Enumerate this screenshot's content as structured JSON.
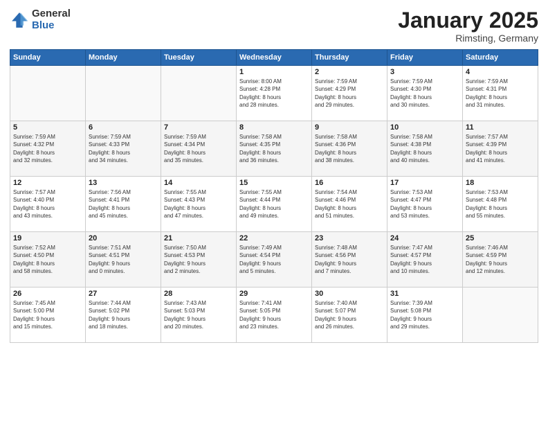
{
  "logo": {
    "general": "General",
    "blue": "Blue"
  },
  "title": "January 2025",
  "subtitle": "Rimsting, Germany",
  "headers": [
    "Sunday",
    "Monday",
    "Tuesday",
    "Wednesday",
    "Thursday",
    "Friday",
    "Saturday"
  ],
  "weeks": [
    [
      {
        "day": "",
        "info": ""
      },
      {
        "day": "",
        "info": ""
      },
      {
        "day": "",
        "info": ""
      },
      {
        "day": "1",
        "info": "Sunrise: 8:00 AM\nSunset: 4:28 PM\nDaylight: 8 hours\nand 28 minutes."
      },
      {
        "day": "2",
        "info": "Sunrise: 7:59 AM\nSunset: 4:29 PM\nDaylight: 8 hours\nand 29 minutes."
      },
      {
        "day": "3",
        "info": "Sunrise: 7:59 AM\nSunset: 4:30 PM\nDaylight: 8 hours\nand 30 minutes."
      },
      {
        "day": "4",
        "info": "Sunrise: 7:59 AM\nSunset: 4:31 PM\nDaylight: 8 hours\nand 31 minutes."
      }
    ],
    [
      {
        "day": "5",
        "info": "Sunrise: 7:59 AM\nSunset: 4:32 PM\nDaylight: 8 hours\nand 32 minutes."
      },
      {
        "day": "6",
        "info": "Sunrise: 7:59 AM\nSunset: 4:33 PM\nDaylight: 8 hours\nand 34 minutes."
      },
      {
        "day": "7",
        "info": "Sunrise: 7:59 AM\nSunset: 4:34 PM\nDaylight: 8 hours\nand 35 minutes."
      },
      {
        "day": "8",
        "info": "Sunrise: 7:58 AM\nSunset: 4:35 PM\nDaylight: 8 hours\nand 36 minutes."
      },
      {
        "day": "9",
        "info": "Sunrise: 7:58 AM\nSunset: 4:36 PM\nDaylight: 8 hours\nand 38 minutes."
      },
      {
        "day": "10",
        "info": "Sunrise: 7:58 AM\nSunset: 4:38 PM\nDaylight: 8 hours\nand 40 minutes."
      },
      {
        "day": "11",
        "info": "Sunrise: 7:57 AM\nSunset: 4:39 PM\nDaylight: 8 hours\nand 41 minutes."
      }
    ],
    [
      {
        "day": "12",
        "info": "Sunrise: 7:57 AM\nSunset: 4:40 PM\nDaylight: 8 hours\nand 43 minutes."
      },
      {
        "day": "13",
        "info": "Sunrise: 7:56 AM\nSunset: 4:41 PM\nDaylight: 8 hours\nand 45 minutes."
      },
      {
        "day": "14",
        "info": "Sunrise: 7:55 AM\nSunset: 4:43 PM\nDaylight: 8 hours\nand 47 minutes."
      },
      {
        "day": "15",
        "info": "Sunrise: 7:55 AM\nSunset: 4:44 PM\nDaylight: 8 hours\nand 49 minutes."
      },
      {
        "day": "16",
        "info": "Sunrise: 7:54 AM\nSunset: 4:46 PM\nDaylight: 8 hours\nand 51 minutes."
      },
      {
        "day": "17",
        "info": "Sunrise: 7:53 AM\nSunset: 4:47 PM\nDaylight: 8 hours\nand 53 minutes."
      },
      {
        "day": "18",
        "info": "Sunrise: 7:53 AM\nSunset: 4:48 PM\nDaylight: 8 hours\nand 55 minutes."
      }
    ],
    [
      {
        "day": "19",
        "info": "Sunrise: 7:52 AM\nSunset: 4:50 PM\nDaylight: 8 hours\nand 58 minutes."
      },
      {
        "day": "20",
        "info": "Sunrise: 7:51 AM\nSunset: 4:51 PM\nDaylight: 9 hours\nand 0 minutes."
      },
      {
        "day": "21",
        "info": "Sunrise: 7:50 AM\nSunset: 4:53 PM\nDaylight: 9 hours\nand 2 minutes."
      },
      {
        "day": "22",
        "info": "Sunrise: 7:49 AM\nSunset: 4:54 PM\nDaylight: 9 hours\nand 5 minutes."
      },
      {
        "day": "23",
        "info": "Sunrise: 7:48 AM\nSunset: 4:56 PM\nDaylight: 9 hours\nand 7 minutes."
      },
      {
        "day": "24",
        "info": "Sunrise: 7:47 AM\nSunset: 4:57 PM\nDaylight: 9 hours\nand 10 minutes."
      },
      {
        "day": "25",
        "info": "Sunrise: 7:46 AM\nSunset: 4:59 PM\nDaylight: 9 hours\nand 12 minutes."
      }
    ],
    [
      {
        "day": "26",
        "info": "Sunrise: 7:45 AM\nSunset: 5:00 PM\nDaylight: 9 hours\nand 15 minutes."
      },
      {
        "day": "27",
        "info": "Sunrise: 7:44 AM\nSunset: 5:02 PM\nDaylight: 9 hours\nand 18 minutes."
      },
      {
        "day": "28",
        "info": "Sunrise: 7:43 AM\nSunset: 5:03 PM\nDaylight: 9 hours\nand 20 minutes."
      },
      {
        "day": "29",
        "info": "Sunrise: 7:41 AM\nSunset: 5:05 PM\nDaylight: 9 hours\nand 23 minutes."
      },
      {
        "day": "30",
        "info": "Sunrise: 7:40 AM\nSunset: 5:07 PM\nDaylight: 9 hours\nand 26 minutes."
      },
      {
        "day": "31",
        "info": "Sunrise: 7:39 AM\nSunset: 5:08 PM\nDaylight: 9 hours\nand 29 minutes."
      },
      {
        "day": "",
        "info": ""
      }
    ]
  ]
}
